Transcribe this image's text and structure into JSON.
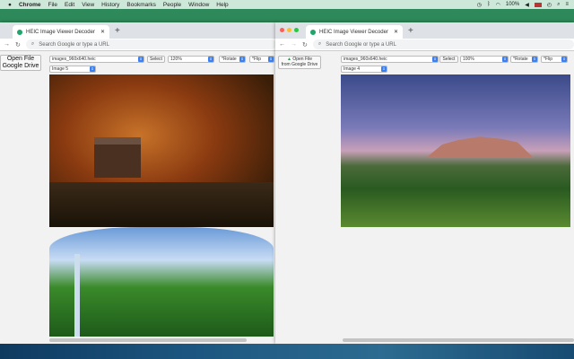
{
  "menubar": {
    "app": "Chrome",
    "items": [
      "File",
      "Edit",
      "View",
      "History",
      "Bookmarks",
      "People",
      "Window",
      "Help"
    ],
    "battery": "100%"
  },
  "left": {
    "tab_title": "HEIC Image Viewer Decoder",
    "omnibox_placeholder": "Search Google or type a URL",
    "open_file": "Open File",
    "google_drive": "Google Drive",
    "file_select": "images_960x640.heic",
    "select_button": "Select",
    "zoom": "120%",
    "rotate": "*Rotate",
    "flip": "*Flip",
    "image_select": "Image 5"
  },
  "right": {
    "tab_title": "HEIC Image Viewer Decoder",
    "omnibox_placeholder": "Search Google or type a URL",
    "open_file": "Open File",
    "google_drive": "from Google Drive",
    "file_select": "images_960x640.heic",
    "select_button": "Select",
    "zoom": "100%",
    "rotate": "*Rotate",
    "flip": "*Flip",
    "image_select": "Image 4"
  }
}
